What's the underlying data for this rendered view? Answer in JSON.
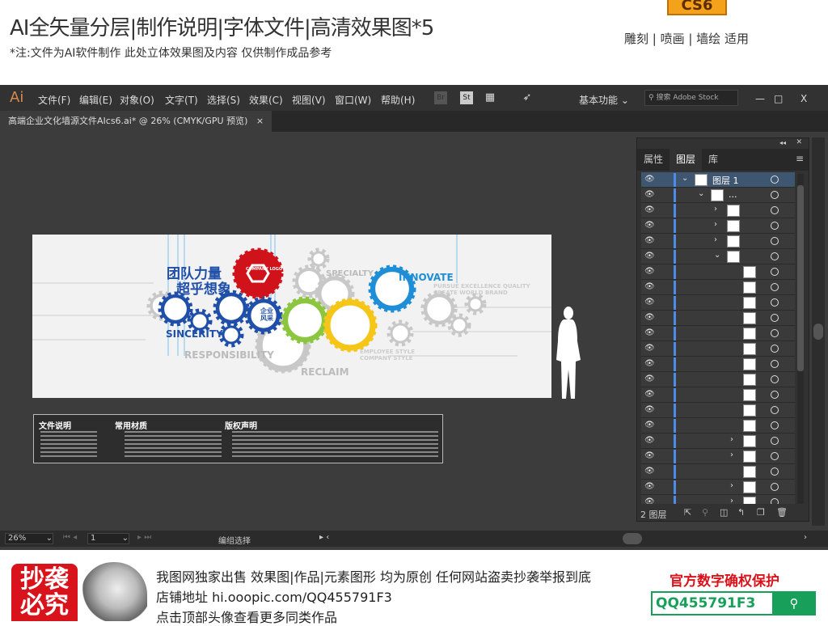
{
  "banner": {
    "title": "AI全矢量分层|制作说明|字体文件|高清效果图*5",
    "subtitle": "*注:文件为AI软件制作 此处立体效果图及内容 仅供制作成品参考",
    "version_badge": "CS6",
    "usage": "雕刻 | 喷画 | 墙绘 适用"
  },
  "app": {
    "logo": "Ai",
    "menu": [
      "文件(F)",
      "编辑(E)",
      "对象(O)",
      "文字(T)",
      "选择(S)",
      "效果(C)",
      "视图(V)",
      "窗口(W)",
      "帮助(H)"
    ],
    "br": "Br",
    "st": "St",
    "workspace": "基本功能",
    "search_placeholder": "搜索 Adobe Stock",
    "window_controls": [
      "—",
      "□",
      "X"
    ],
    "doc_tab": "高端企业文化墙源文件AIcs6.ai* @ 26% (CMYK/GPU 预览)",
    "doc_close": "×"
  },
  "artwork": {
    "headline1": "团队力量",
    "headline2": "超乎想象",
    "logo_text": "COMPANY LOGO",
    "center": "企业风采",
    "words": {
      "sincerity": "SINCERITY",
      "responsibility": "RESPONSIBILITY",
      "specialty": "SPECIALTY",
      "innovate": "INNOVATE",
      "reclaim": "RECLAIM",
      "pursue": "PURSUE EXCELLENCE QUALITY",
      "create": "CREATE WORLD BRAND",
      "employee": "EMPLOYEE STYLE",
      "company": "COMPANY STYLE"
    },
    "colors": {
      "blue": "#1f4fa8",
      "red": "#d0121b",
      "green": "#8cc63f",
      "yellow": "#f5c518",
      "sky": "#1e8ed6",
      "grey": "#c8c8c8"
    }
  },
  "infobox": {
    "sections": [
      "文件说明",
      "常用材质",
      "版权声明"
    ]
  },
  "layers_panel": {
    "tabs": [
      "属性",
      "图层",
      "库"
    ],
    "active_tab": "图层",
    "rows": [
      {
        "label": "图层 1",
        "chevron": "down",
        "level": 0,
        "selected": true
      },
      {
        "label": "...",
        "chevron": "down",
        "level": 1
      },
      {
        "chevron": "right",
        "level": 2
      },
      {
        "chevron": "right",
        "level": 2
      },
      {
        "chevron": "right",
        "level": 2
      },
      {
        "chevron": "down",
        "level": 2
      },
      {
        "level": 3
      },
      {
        "level": 3
      },
      {
        "level": 3
      },
      {
        "level": 3
      },
      {
        "level": 3
      },
      {
        "level": 3
      },
      {
        "level": 3
      },
      {
        "level": 3
      },
      {
        "level": 3
      },
      {
        "level": 3
      },
      {
        "level": 3
      },
      {
        "chevron": "right",
        "level": 3
      },
      {
        "chevron": "right",
        "level": 3
      },
      {
        "level": 3
      },
      {
        "chevron": "right",
        "level": 3
      },
      {
        "chevron": "right",
        "level": 3
      }
    ],
    "footer": "2 图层"
  },
  "status": {
    "zoom": "26%",
    "page": "1",
    "tool": "编组选择"
  },
  "footer": {
    "stamp": "抄袭必究",
    "line1": "我图网独家出售 效果图|作品|元素图形 均为原创 任何网站盗卖抄袭举报到底",
    "line2": "店铺地址 hi.ooopic.com/QQ455791F3",
    "line3": "点击顶部头像查看更多同类作品",
    "protect": "官方数字确权保护",
    "code": "QQ455791F3"
  }
}
